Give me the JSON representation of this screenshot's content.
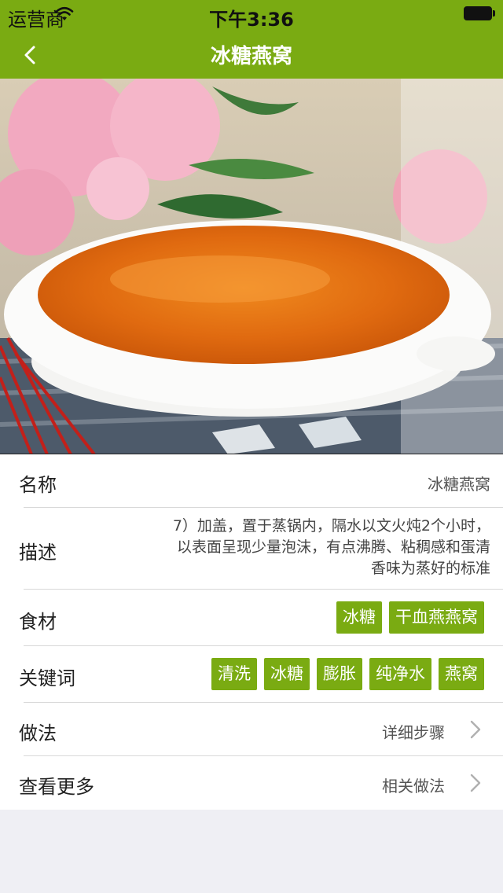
{
  "status_bar": {
    "carrier": "运营商",
    "time": "下午3:36"
  },
  "nav": {
    "title": "冰糖燕窝"
  },
  "details": {
    "name": {
      "label": "名称",
      "value": "冰糖燕窝"
    },
    "description": {
      "label": "描述",
      "lines": [
        "7）加盖，置于蒸锅内，隔水以文火炖2个小时，",
        "以表面呈现少量泡沫，有点沸腾、粘稠感和蛋清",
        "香味为蒸好的标准"
      ]
    },
    "ingredients": {
      "label": "食材",
      "tags": [
        "冰糖",
        "干血燕燕窝"
      ]
    },
    "keywords": {
      "label": "关键词",
      "tags": [
        "清洗",
        "冰糖",
        "膨胀",
        "纯净水",
        "燕窝"
      ]
    },
    "method": {
      "label": "做法",
      "link": "详细步骤"
    },
    "more": {
      "label": "查看更多",
      "link": "相关做法"
    }
  },
  "colors": {
    "accent": "#7aab12",
    "background": "#efeff4"
  },
  "icons": {
    "back": "chevron-left-icon",
    "wifi": "wifi-icon",
    "battery": "battery-icon",
    "disclosure": "chevron-right-icon"
  }
}
